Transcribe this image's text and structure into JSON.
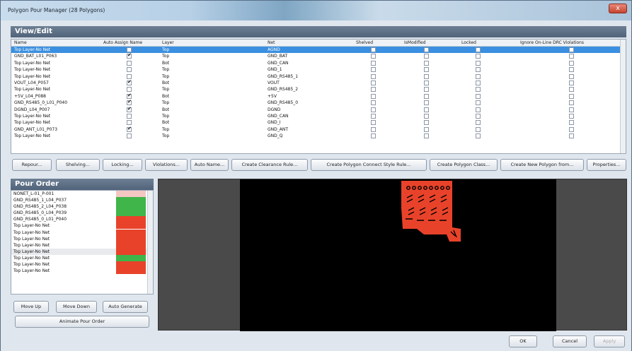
{
  "window": {
    "title": "Polygon Pour Manager (28 Polygons)",
    "close": "x"
  },
  "view_edit": {
    "heading": "View/Edit",
    "columns": [
      "Name",
      "Auto Assign Name",
      "Layer",
      "Net",
      "Shelved",
      "IsModified",
      "Locked",
      "Ignore On-Line DRC Violations"
    ],
    "rows": [
      {
        "name": "Top Layer-No Net",
        "auto": false,
        "layer": "Top",
        "net": "AGND",
        "selected": true
      },
      {
        "name": "GND_BAT_L01_P063",
        "auto": true,
        "layer": "Top",
        "net": "GND_BAT"
      },
      {
        "name": "Top Layer-No Net",
        "auto": false,
        "layer": "Bot",
        "net": "GND_CAN"
      },
      {
        "name": "Top Layer-No Net",
        "auto": false,
        "layer": "Top",
        "net": "GND_1"
      },
      {
        "name": "Top Layer-No Net",
        "auto": false,
        "layer": "Top",
        "net": "GND_RS485_1"
      },
      {
        "name": "VOUT_L04_P057",
        "auto": true,
        "layer": "Bot",
        "net": "VOUT"
      },
      {
        "name": "Top Layer-No Net",
        "auto": false,
        "layer": "Top",
        "net": "GND_RS485_2"
      },
      {
        "name": "+5V_L04_P088",
        "auto": true,
        "layer": "Bot",
        "net": "+5V"
      },
      {
        "name": "GND_RS485_0_L01_P040",
        "auto": true,
        "layer": "Top",
        "net": "GND_RS485_0"
      },
      {
        "name": "DGND_L04_P007",
        "auto": true,
        "layer": "Bot",
        "net": "DGND"
      },
      {
        "name": "Top Layer-No Net",
        "auto": false,
        "layer": "Top",
        "net": "GND_CAN"
      },
      {
        "name": "Top Layer-No Net",
        "auto": false,
        "layer": "Bot",
        "net": "GND_I"
      },
      {
        "name": "GND_ANT_L01_P073",
        "auto": true,
        "layer": "Top",
        "net": "GND_ANT"
      },
      {
        "name": "Top Layer-No Net",
        "auto": false,
        "layer": "Top",
        "net": "GND_Q"
      }
    ]
  },
  "buttons": {
    "repour": "Repour...",
    "shelving": "Shelving...",
    "locking": "Locking...",
    "violations": "Violations...",
    "auto_name": "Auto Name...",
    "create_clearance": "Create Clearance Rule...",
    "create_connect": "Create Polygon Connect Style Rule...",
    "create_class": "Create Polygon Class...",
    "create_new": "Create New Polygon from...",
    "properties": "Properties..."
  },
  "pour_order": {
    "heading": "Pour Order",
    "items": [
      {
        "name": "NONET_L-01_P-001",
        "color": "#f4c7c3"
      },
      {
        "name": "GND_RS485_1_L04_P037",
        "color": "#3fb54a"
      },
      {
        "name": "GND_RS485_2_L04_P038",
        "color": "#3fb54a"
      },
      {
        "name": "GND_RS485_0_L04_P039",
        "color": "#3fb54a"
      },
      {
        "name": "GND_RS485_0_L01_P040",
        "color": "#e8432a"
      },
      {
        "name": "Top Layer-No Net",
        "color": "#e8432a"
      },
      {
        "name": "Top Layer-No Net",
        "color": "#e8432a"
      },
      {
        "name": "Top Layer-No Net",
        "color": "#e8432a"
      },
      {
        "name": "Top Layer-No Net",
        "color": "#e8432a"
      },
      {
        "name": "Top Layer-No Net",
        "color": "#e8432a",
        "highlight": true
      },
      {
        "name": "Top Layer-No Net",
        "color": "#3fb54a"
      },
      {
        "name": "Top Layer-No Net",
        "color": "#e8432a"
      },
      {
        "name": "Top Layer-No Net",
        "color": "#e8432a"
      }
    ],
    "move_up": "Move Up",
    "move_down": "Move Down",
    "auto_generate": "Auto Generate",
    "animate": "Animate Pour Order"
  },
  "footer": {
    "ok": "OK",
    "cancel": "Cancel",
    "apply": "Apply"
  },
  "colors": {
    "accent": "#3a8fe0",
    "polygon": "#e8432a"
  }
}
